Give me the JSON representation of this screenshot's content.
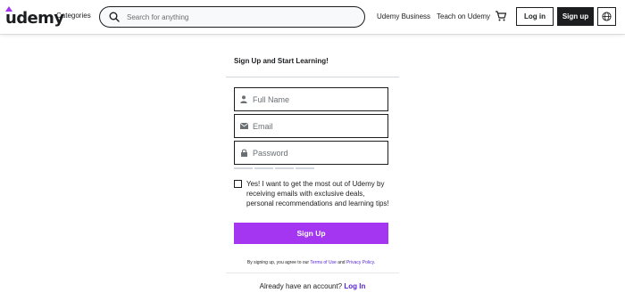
{
  "header": {
    "logo_text": "udemy",
    "categories_label": "Categories",
    "search_placeholder": "Search for anything",
    "business_label": "Udemy Business",
    "teach_label": "Teach on Udemy",
    "login_label": "Log in",
    "signup_label": "Sign up",
    "icons": [
      "search-icon",
      "cart-icon",
      "globe-icon"
    ]
  },
  "form": {
    "title": "Sign Up and Start Learning!",
    "fullname_placeholder": "Full Name",
    "email_placeholder": "Email",
    "password_placeholder": "Password",
    "password_strength_segments": 4,
    "consent_text": "Yes! I want to get the most out of Udemy by receiving emails with exclusive deals, personal recommendations and learning tips!",
    "consent_checked": false,
    "submit_label": "Sign Up",
    "terms_prefix": "By signing up, you agree to our ",
    "terms_link": "Terms of Use",
    "terms_and": " and ",
    "privacy_link": "Privacy Policy",
    "terms_suffix": ".",
    "already_text": "Already have an account? ",
    "login_link": "Log In"
  },
  "colors": {
    "brand_purple": "#a435f0",
    "link_purple": "#5624d0",
    "dark": "#1c1d1f"
  }
}
